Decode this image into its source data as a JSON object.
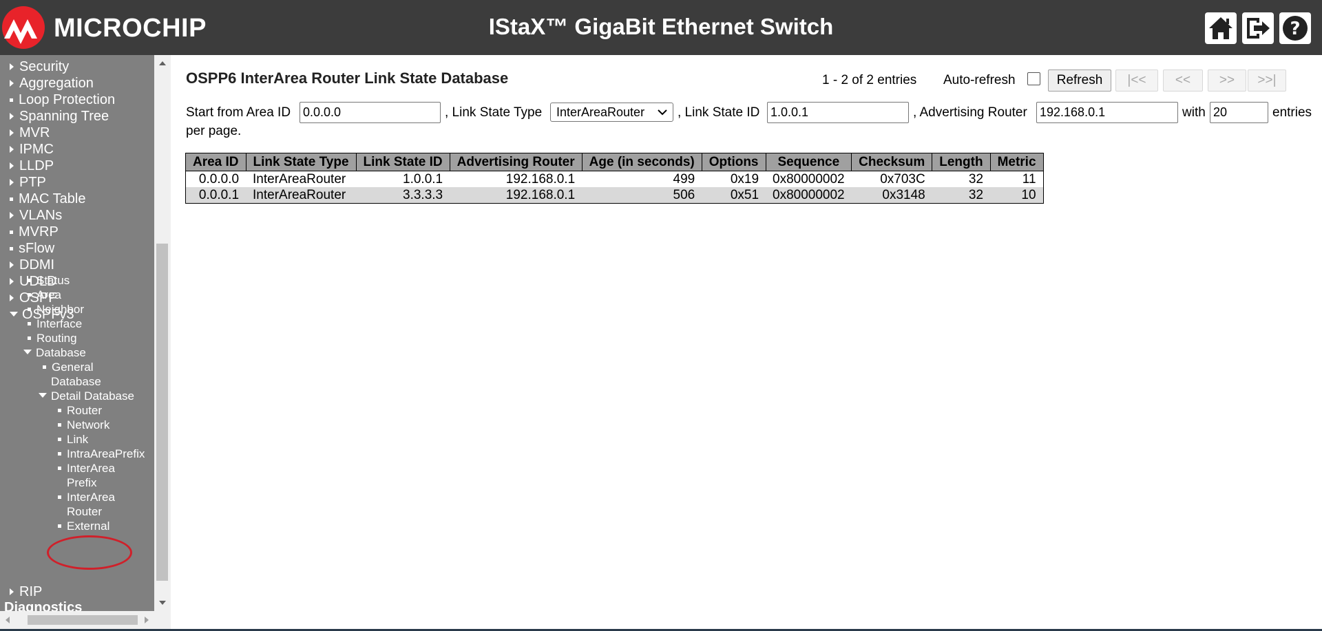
{
  "header": {
    "logo_text": "MICROCHIP",
    "title": "IStaX™ GigaBit Ethernet Switch",
    "bg_color": "#3c3c3c",
    "buttons": [
      {
        "name": "home-icon"
      },
      {
        "name": "logout-icon"
      },
      {
        "name": "help-icon"
      }
    ]
  },
  "sidebar": {
    "items": [
      {
        "label": "Security",
        "icon": "triangle-right"
      },
      {
        "label": "Aggregation",
        "icon": "triangle-right"
      },
      {
        "label": "Loop Protection",
        "icon": "square"
      },
      {
        "label": "Spanning Tree",
        "icon": "triangle-right"
      },
      {
        "label": "MVR",
        "icon": "triangle-right"
      },
      {
        "label": "IPMC",
        "icon": "triangle-right"
      },
      {
        "label": "LLDP",
        "icon": "triangle-right"
      },
      {
        "label": "PTP",
        "icon": "triangle-right"
      },
      {
        "label": "MAC Table",
        "icon": "square"
      },
      {
        "label": "VLANs",
        "icon": "triangle-right"
      },
      {
        "label": "MVRP",
        "icon": "square"
      },
      {
        "label": "sFlow",
        "icon": "square"
      },
      {
        "label": "DDMI",
        "icon": "triangle-right"
      },
      {
        "label": "UDLD",
        "icon": "triangle-right"
      },
      {
        "label": "OSPF",
        "icon": "triangle-right"
      },
      {
        "label": "OSPFv3",
        "icon": "triangle-down"
      }
    ],
    "ospfv3_items": [
      "Status",
      "Area",
      "Neighbor",
      "Interface",
      "Routing",
      "Database"
    ],
    "database_items": {
      "general_line1": "General",
      "general_line2": "Database",
      "detail": "Detail Database"
    },
    "detail_items": {
      "router": "Router",
      "network": "Network",
      "link": "Link",
      "intra": "IntraAreaPrefix",
      "inter_prefix_1": "InterArea",
      "inter_prefix_2": "Prefix",
      "inter_router_1": "InterArea",
      "inter_router_2": "Router",
      "external": "External"
    },
    "rip": "RIP",
    "diagnostics": "Diagnostics",
    "bg_color": "#808080"
  },
  "main": {
    "title": "OSPP6 InterArea Router Link State Database",
    "entries_info": "1 - 2 of 2 entries",
    "auto_refresh_label": "Auto-refresh",
    "auto_refresh_checked": false,
    "buttons": {
      "refresh": "Refresh",
      "first": "|<<",
      "prev": "<<",
      "next": ">>",
      "last": ">>|"
    },
    "filter": {
      "start_label": "Start from Area ID",
      "area_id": "0.0.0.0",
      "lstype_label": ", Link State Type",
      "lstype_value": "InterAreaRouter",
      "lsid_label": ", Link State ID",
      "lsid_value": "1.0.0.1",
      "advrouter_label": ", Advertising Router",
      "advrouter_value": "192.168.0.1",
      "with_label": "with",
      "per_page_value": "20",
      "entries_label": "entries",
      "per_page_text": "per page."
    },
    "table": {
      "headers": [
        "Area ID",
        "Link State Type",
        "Link State ID",
        "Advertising Router",
        "Age (in seconds)",
        "Options",
        "Sequence",
        "Checksum",
        "Length",
        "Metric"
      ],
      "rows": [
        [
          "0.0.0.0",
          "InterAreaRouter",
          "1.0.0.1",
          "192.168.0.1",
          "499",
          "0x19",
          "0x80000002",
          "0x703C",
          "32",
          "11"
        ],
        [
          "0.0.0.1",
          "InterAreaRouter",
          "3.3.3.3",
          "192.168.0.1",
          "506",
          "0x51",
          "0x80000002",
          "0x3148",
          "32",
          "10"
        ]
      ]
    }
  },
  "colors": {
    "highlight_ring": "#d0202a",
    "logo_red": "#e8232a",
    "table_header": "#a0a0a0",
    "row_alt": "#d9d9d9"
  }
}
